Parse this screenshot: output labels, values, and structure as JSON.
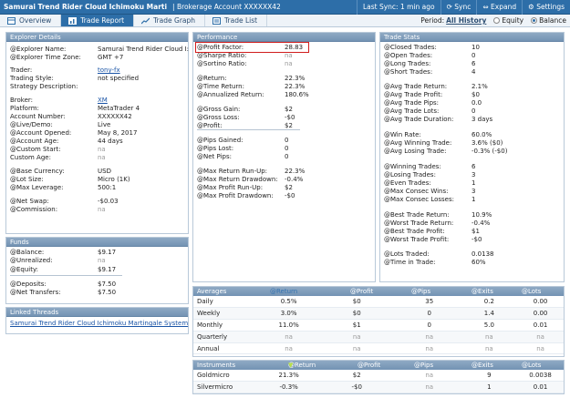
{
  "topbar": {
    "title": "Samurai Trend Rider Cloud Ichimoku Marti",
    "account": "| Brokerage Account XXXXXX42",
    "last_sync": "Last Sync: 1 min ago",
    "sync": "Sync",
    "expand": "Expand",
    "settings": "Settings"
  },
  "tabs": [
    {
      "label": "Overview"
    },
    {
      "label": "Trade Report"
    },
    {
      "label": "Trade Graph"
    },
    {
      "label": "Trade List"
    }
  ],
  "period": {
    "label": "Period:",
    "value": "All History",
    "equity": "Equity",
    "balance": "Balance"
  },
  "explorer": {
    "title": "Explorer Details",
    "rows": [
      {
        "label": "@Explorer Name:",
        "value": "Samurai Trend Rider Cloud I:"
      },
      {
        "label": "@Explorer Time Zone:",
        "value": "GMT +7"
      },
      {
        "label": "Trader:",
        "value": "tony-fx"
      },
      {
        "label": "Trading Style:",
        "value": "not specified"
      },
      {
        "label": "Strategy Description:",
        "value": ""
      },
      {
        "label": "Broker:",
        "value": "XM"
      },
      {
        "label": "Platform:",
        "value": "MetaTrader 4"
      },
      {
        "label": "Account Number:",
        "value": "XXXXXX42"
      },
      {
        "label": "@Live/Demo:",
        "value": "Live"
      },
      {
        "label": "@Account Opened:",
        "value": "May 8, 2017"
      },
      {
        "label": "@Account Age:",
        "value": "44 days"
      },
      {
        "label": "@Custom Start:",
        "value": "na"
      },
      {
        "label": "Custom Age:",
        "value": "na"
      },
      {
        "label": "@Base Currency:",
        "value": "USD"
      },
      {
        "label": "@Lot Size:",
        "value": "Micro (1K)"
      },
      {
        "label": "@Max Leverage:",
        "value": "500:1"
      },
      {
        "label": "@Net Swap:",
        "value": "-$0.03"
      },
      {
        "label": "@Commission:",
        "value": "na"
      }
    ]
  },
  "funds": {
    "title": "Funds",
    "rows": [
      {
        "label": "@Balance:",
        "value": "$9.17"
      },
      {
        "label": "@Unrealized:",
        "value": "na"
      },
      {
        "label": "@Equity:",
        "value": "$9.17"
      },
      {
        "label": "@Deposits:",
        "value": "$7.50"
      },
      {
        "label": "@Net Transfers:",
        "value": "$7.50"
      }
    ]
  },
  "linked": {
    "title": "Linked Threads",
    "link": "Samurai Trend Rider Cloud Ichimoku Martingale System"
  },
  "performance": {
    "title": "Performance",
    "rows": [
      {
        "label": "@Profit Factor:",
        "value": "28.83"
      },
      {
        "label": "@Sharpe Ratio:",
        "value": "na"
      },
      {
        "label": "@Sortino Ratio:",
        "value": "na"
      },
      {
        "label": "@Return:",
        "value": "22.3%"
      },
      {
        "label": "@Time Return:",
        "value": "22.3%"
      },
      {
        "label": "@Annualized Return:",
        "value": "180.6%"
      },
      {
        "label": "@Gross Gain:",
        "value": "$2"
      },
      {
        "label": "@Gross Loss:",
        "value": "-$0"
      },
      {
        "label": "@Profit:",
        "value": "$2"
      },
      {
        "label": "@Pips Gained:",
        "value": "0"
      },
      {
        "label": "@Pips Lost:",
        "value": "0"
      },
      {
        "label": "@Net Pips:",
        "value": "0"
      },
      {
        "label": "@Max Return Run-Up:",
        "value": "22.3%"
      },
      {
        "label": "@Max Return Drawdown:",
        "value": "-0.4%"
      },
      {
        "label": "@Max Profit Run-Up:",
        "value": "$2"
      },
      {
        "label": "@Max Profit Drawdown:",
        "value": "-$0"
      }
    ]
  },
  "tradestats": {
    "title": "Trade Stats",
    "rows": [
      {
        "label": "@Closed Trades:",
        "value": "10"
      },
      {
        "label": "@Open Trades:",
        "value": "0"
      },
      {
        "label": "@Long Trades:",
        "value": "6"
      },
      {
        "label": "@Short Trades:",
        "value": "4"
      },
      {
        "label": "@Avg Trade Return:",
        "value": "2.1%"
      },
      {
        "label": "@Avg Trade Profit:",
        "value": "$0"
      },
      {
        "label": "@Avg Trade Pips:",
        "value": "0.0"
      },
      {
        "label": "@Avg Trade Lots:",
        "value": "0"
      },
      {
        "label": "@Avg Trade Duration:",
        "value": "3 days"
      },
      {
        "label": "@Win Rate:",
        "value": "60.0%"
      },
      {
        "label": "@Avg Winning Trade:",
        "value": "3.6% ($0)"
      },
      {
        "label": "@Avg Losing Trade:",
        "value": "-0.3% (-$0)"
      },
      {
        "label": "@Winning Trades:",
        "value": "6"
      },
      {
        "label": "@Losing Trades:",
        "value": "3"
      },
      {
        "label": "@Even Trades:",
        "value": "1"
      },
      {
        "label": "@Max Consec Wins:",
        "value": "3"
      },
      {
        "label": "@Max Consec Losses:",
        "value": "1"
      },
      {
        "label": "@Best Trade Return:",
        "value": "10.9%"
      },
      {
        "label": "@Worst Trade Return:",
        "value": "-0.4%"
      },
      {
        "label": "@Best Trade Profit:",
        "value": "$1"
      },
      {
        "label": "@Worst Trade Profit:",
        "value": "-$0"
      },
      {
        "label": "@Lots Traded:",
        "value": "0.0138"
      },
      {
        "label": "@Time in Trade:",
        "value": "60%"
      }
    ]
  },
  "averages": {
    "title": "Averages",
    "cols": [
      "@Return",
      "@Profit",
      "@Pips",
      "@Exits",
      "@Lots"
    ],
    "rows": [
      {
        "name": "Daily",
        "cells": [
          "0.5%",
          "$0",
          "35",
          "0.2",
          "0.00"
        ]
      },
      {
        "name": "Weekly",
        "cells": [
          "3.0%",
          "$0",
          "0",
          "1.4",
          "0.00"
        ]
      },
      {
        "name": "Monthly",
        "cells": [
          "11.0%",
          "$1",
          "0",
          "5.0",
          "0.01"
        ]
      },
      {
        "name": "Quarterly",
        "cells": [
          "na",
          "na",
          "na",
          "na",
          "na"
        ]
      },
      {
        "name": "Annual",
        "cells": [
          "na",
          "na",
          "na",
          "na",
          "na"
        ]
      }
    ]
  },
  "instruments": {
    "title": "Instruments",
    "cols": [
      "@Return",
      "@Profit",
      "@Pips",
      "@Exits",
      "@Lots"
    ],
    "rows": [
      {
        "name": "Goldmicro",
        "cells": [
          "21.3%",
          "$2",
          "na",
          "9",
          "0.0038"
        ]
      },
      {
        "name": "Silvermicro",
        "cells": [
          "-0.3%",
          "-$0",
          "na",
          "1",
          "0.01"
        ]
      }
    ]
  },
  "colors": {
    "header": "#2d6ea8",
    "panel_head": "#7f9dbc",
    "highlight": "#d01d1d"
  }
}
